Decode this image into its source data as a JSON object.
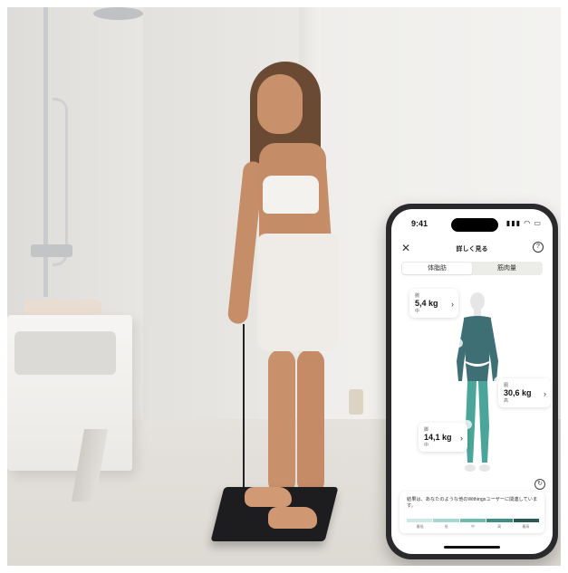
{
  "phone": {
    "status_time": "9:41",
    "status_icons": "▮▮▮ ◠ ▭",
    "close_symbol": "✕",
    "title": "詳しく見る",
    "help_symbol": "?",
    "tabs": [
      {
        "label": "体脂肪",
        "active": true
      },
      {
        "label": "筋肉量",
        "active": false
      }
    ],
    "cards": {
      "arm": {
        "label": "腕",
        "value": "5,4 kg",
        "level": "中"
      },
      "trunk": {
        "label": "胴",
        "value": "30,6 kg",
        "level": "高"
      },
      "leg": {
        "label": "脚",
        "value": "14,1 kg",
        "level": "中"
      }
    },
    "chevron": "›",
    "rotate_symbol": "↻",
    "result_text": "結果は、あなたのような他のWithingsユーザーに関連しています。",
    "scale_bar": {
      "colors": [
        "#cfe9e4",
        "#a6d8cf",
        "#6cbcb0",
        "#3d8f86",
        "#2a5a58"
      ],
      "labels": [
        "最低",
        "低",
        "中",
        "高",
        "最高"
      ]
    },
    "figure_colors": {
      "upper": "#3e6f74",
      "lower": "#4aa69a",
      "base": "#e6e6e6",
      "highlight": "#ffffff"
    }
  }
}
